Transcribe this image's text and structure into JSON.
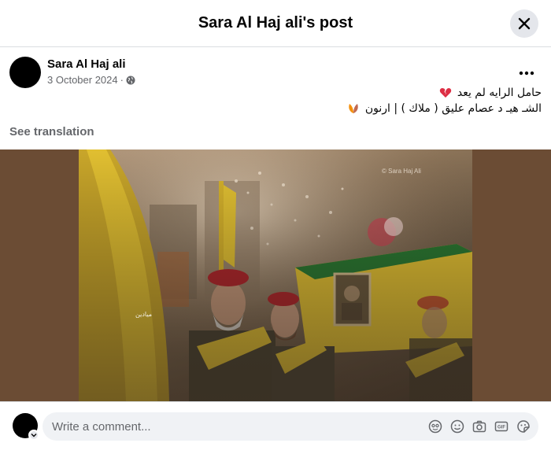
{
  "header": {
    "title": "Sara Al Haj ali's post",
    "close_icon": "close-icon"
  },
  "post": {
    "author": "Sara Al Haj ali",
    "date": "3 October 2024",
    "separator": "·",
    "audience_icon": "globe-icon",
    "more_icon": "more-horizontal-icon",
    "text_line_1": "حامل الرايه لم يعد",
    "text_line_2": "الشـ هيـ د  عصام عليق ( ملاك ) | ارنون",
    "see_translation": "See translation"
  },
  "media": {
    "watermark": "© Sara Haj Ali",
    "badge_text": "ميادين"
  },
  "composer": {
    "placeholder": "Write a comment...",
    "icons": [
      "avatar-sticker-icon",
      "emoji-icon",
      "camera-icon",
      "gif-icon",
      "sticker-icon"
    ]
  },
  "colors": {
    "accent_bg": "#e4e6eb",
    "muted_text": "#65676b",
    "input_bg": "#f0f2f5",
    "flag_yellow": "#e5c333",
    "flag_green": "#2a7a32",
    "beret_red": "#b3262c"
  }
}
